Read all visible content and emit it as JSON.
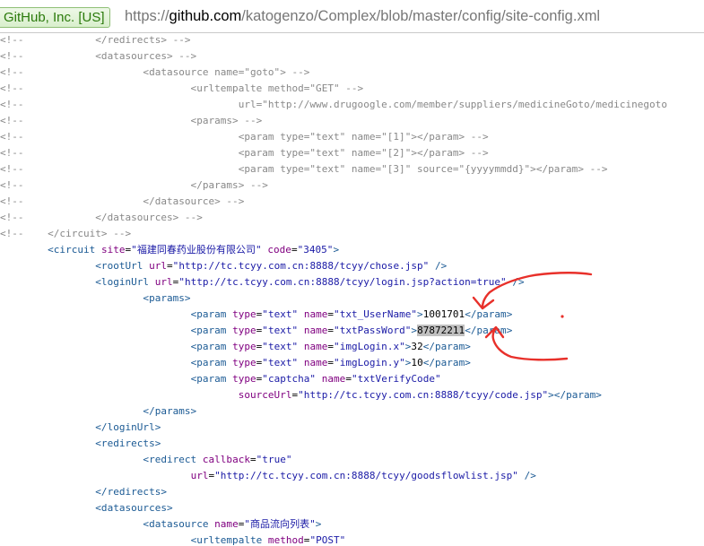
{
  "address_bar": {
    "identity": "GitHub, Inc. [US]",
    "url_scheme": "https://",
    "url_host": "github.com",
    "url_path": "/katogenzo/Complex/blob/master/config/site-config.xml"
  },
  "annotation_color": "#e8302a",
  "lines": [
    [
      [
        "c",
        "<!--            </redirects> -->"
      ]
    ],
    [
      [
        "c",
        "<!--            <datasources> -->"
      ]
    ],
    [
      [
        "c",
        "<!--                    <datasource name=\"goto\"> -->"
      ]
    ],
    [
      [
        "c",
        "<!--                            <urltempalte method=\"GET\" -->"
      ]
    ],
    [
      [
        "c",
        "<!--                                    url=\"http://www.drugoogle.com/member/suppliers/medicineGoto/medicinegoto"
      ]
    ],
    [
      [
        "c",
        "<!--                            <params> -->"
      ]
    ],
    [
      [
        "c",
        "<!--                                    <param type=\"text\" name=\"[1]\"></param> -->"
      ]
    ],
    [
      [
        "c",
        "<!--                                    <param type=\"text\" name=\"[2]\"></param> -->"
      ]
    ],
    [
      [
        "c",
        "<!--                                    <param type=\"text\" name=\"[3]\" source=\"{yyyymmdd}\"></param> -->"
      ]
    ],
    [
      [
        "c",
        "<!--                            </params> -->"
      ]
    ],
    [
      [
        "c",
        "<!--                    </datasource> -->"
      ]
    ],
    [
      [
        "c",
        "<!--            </datasources> -->"
      ]
    ],
    [
      [
        "c",
        "<!--    </circuit> -->"
      ]
    ],
    [
      [
        "x",
        "        "
      ],
      [
        "t",
        "<circuit "
      ],
      [
        "a",
        "site"
      ],
      [
        "x",
        "="
      ],
      [
        "v",
        "\"福建同春药业股份有限公司\""
      ],
      [
        "x",
        " "
      ],
      [
        "a",
        "code"
      ],
      [
        "x",
        "="
      ],
      [
        "v",
        "\"3405\""
      ],
      [
        "t",
        ">"
      ]
    ],
    [
      [
        "x",
        "                "
      ],
      [
        "t",
        "<rootUrl "
      ],
      [
        "a",
        "url"
      ],
      [
        "x",
        "="
      ],
      [
        "v",
        "\"http://tc.tcyy.com.cn:8888/tcyy/chose.jsp\""
      ],
      [
        "x",
        " "
      ],
      [
        "t",
        "/>"
      ]
    ],
    [
      [
        "x",
        "                "
      ],
      [
        "t",
        "<loginUrl "
      ],
      [
        "a",
        "url"
      ],
      [
        "x",
        "="
      ],
      [
        "v",
        "\"http://tc.tcyy.com.cn:8888/tcyy/login.jsp?action=true\""
      ],
      [
        "x",
        " "
      ],
      [
        "t",
        "/>"
      ]
    ],
    [
      [
        "x",
        "                        "
      ],
      [
        "t",
        "<params>"
      ]
    ],
    [
      [
        "x",
        "                                "
      ],
      [
        "t",
        "<param "
      ],
      [
        "a",
        "type"
      ],
      [
        "x",
        "="
      ],
      [
        "v",
        "\"text\""
      ],
      [
        "x",
        " "
      ],
      [
        "a",
        "name"
      ],
      [
        "x",
        "="
      ],
      [
        "v",
        "\"txt_UserName\""
      ],
      [
        "t",
        ">"
      ],
      [
        "x",
        "1001701"
      ],
      [
        "t",
        "</param>"
      ]
    ],
    [
      [
        "x",
        "                                "
      ],
      [
        "t",
        "<param "
      ],
      [
        "a",
        "type"
      ],
      [
        "x",
        "="
      ],
      [
        "v",
        "\"text\""
      ],
      [
        "x",
        " "
      ],
      [
        "a",
        "name"
      ],
      [
        "x",
        "="
      ],
      [
        "v",
        "\"txtPassWord\""
      ],
      [
        "t",
        ">"
      ],
      [
        "hl",
        "87872211"
      ],
      [
        "t",
        "</param>"
      ]
    ],
    [
      [
        "x",
        "                                "
      ],
      [
        "t",
        "<param "
      ],
      [
        "a",
        "type"
      ],
      [
        "x",
        "="
      ],
      [
        "v",
        "\"text\""
      ],
      [
        "x",
        " "
      ],
      [
        "a",
        "name"
      ],
      [
        "x",
        "="
      ],
      [
        "v",
        "\"imgLogin.x\""
      ],
      [
        "t",
        ">"
      ],
      [
        "x",
        "32"
      ],
      [
        "t",
        "</param>"
      ]
    ],
    [
      [
        "x",
        "                                "
      ],
      [
        "t",
        "<param "
      ],
      [
        "a",
        "type"
      ],
      [
        "x",
        "="
      ],
      [
        "v",
        "\"text\""
      ],
      [
        "x",
        " "
      ],
      [
        "a",
        "name"
      ],
      [
        "x",
        "="
      ],
      [
        "v",
        "\"imgLogin.y\""
      ],
      [
        "t",
        ">"
      ],
      [
        "x",
        "10"
      ],
      [
        "t",
        "</param>"
      ]
    ],
    [
      [
        "x",
        "                                "
      ],
      [
        "t",
        "<param "
      ],
      [
        "a",
        "type"
      ],
      [
        "x",
        "="
      ],
      [
        "v",
        "\"captcha\""
      ],
      [
        "x",
        " "
      ],
      [
        "a",
        "name"
      ],
      [
        "x",
        "="
      ],
      [
        "v",
        "\"txtVerifyCode\""
      ]
    ],
    [
      [
        "x",
        "                                        "
      ],
      [
        "a",
        "sourceUrl"
      ],
      [
        "x",
        "="
      ],
      [
        "v",
        "\"http://tc.tcyy.com.cn:8888/tcyy/code.jsp\""
      ],
      [
        "t",
        "></param>"
      ]
    ],
    [
      [
        "x",
        "                        "
      ],
      [
        "t",
        "</params>"
      ]
    ],
    [
      [
        "x",
        "                "
      ],
      [
        "t",
        "</loginUrl>"
      ]
    ],
    [
      [
        "x",
        "                "
      ],
      [
        "t",
        "<redirects>"
      ]
    ],
    [
      [
        "x",
        "                        "
      ],
      [
        "t",
        "<redirect "
      ],
      [
        "a",
        "callback"
      ],
      [
        "x",
        "="
      ],
      [
        "v",
        "\"true\""
      ]
    ],
    [
      [
        "x",
        "                                "
      ],
      [
        "a",
        "url"
      ],
      [
        "x",
        "="
      ],
      [
        "v",
        "\"http://tc.tcyy.com.cn:8888/tcyy/goodsflowlist.jsp\""
      ],
      [
        "x",
        " "
      ],
      [
        "t",
        "/>"
      ]
    ],
    [
      [
        "x",
        "                "
      ],
      [
        "t",
        "</redirects>"
      ]
    ],
    [
      [
        "x",
        "                "
      ],
      [
        "t",
        "<datasources>"
      ]
    ],
    [
      [
        "x",
        "                        "
      ],
      [
        "t",
        "<datasource "
      ],
      [
        "a",
        "name"
      ],
      [
        "x",
        "="
      ],
      [
        "v",
        "\"商品流向列表\""
      ],
      [
        "t",
        ">"
      ]
    ],
    [
      [
        "x",
        "                                "
      ],
      [
        "t",
        "<urltempalte "
      ],
      [
        "a",
        "method"
      ],
      [
        "x",
        "="
      ],
      [
        "v",
        "\"POST\""
      ]
    ]
  ]
}
